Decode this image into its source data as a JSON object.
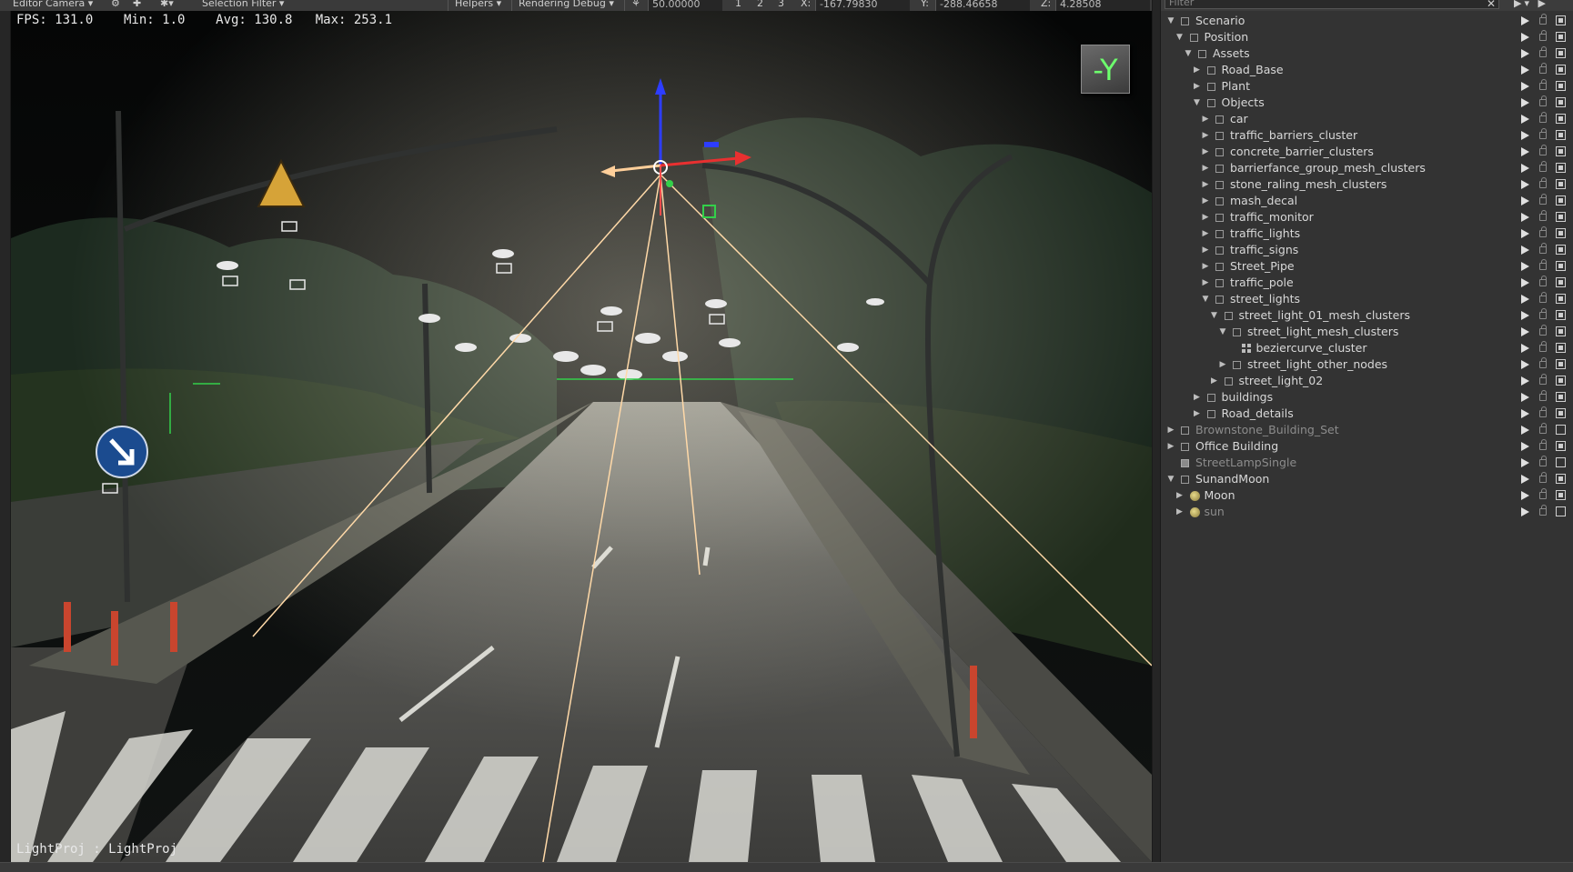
{
  "toolbar": {
    "camera": "Editor Camera ▾",
    "selection_filter": "Selection Filter ▾",
    "helpers": "Helpers ▾",
    "rendering_debug": "Rendering Debug ▾",
    "speed_value": "50.00000",
    "view_1": "1",
    "view_2": "2",
    "view_3": "3",
    "x_label": "X:",
    "x_value": "-167.79830",
    "y_label": "Y:",
    "y_value": "-288.46658",
    "z_label": "Z:",
    "z_value": "4.28508"
  },
  "viewport": {
    "stats": "FPS: 131.0    Min: 1.0    Avg: 130.8   Max: 253.1",
    "axis_label": "-Y",
    "camera_caption": "LightProj : LightProj"
  },
  "panel": {
    "filter_placeholder": "Filter",
    "clear_glyph": "✕",
    "tools_glyph": "▶▾ ▶"
  },
  "tree": [
    {
      "label": "Scenario",
      "depth": 0,
      "arrow": "▼",
      "icon": "checkbox",
      "dim": false,
      "visible": true
    },
    {
      "label": "Position",
      "depth": 1,
      "arrow": "▼",
      "icon": "checkbox",
      "dim": false,
      "visible": true
    },
    {
      "label": "Assets",
      "depth": 2,
      "arrow": "▼",
      "icon": "checkbox",
      "dim": false,
      "visible": true
    },
    {
      "label": "Road_Base",
      "depth": 3,
      "arrow": "▶",
      "icon": "checkbox",
      "dim": false,
      "visible": true
    },
    {
      "label": "Plant",
      "depth": 3,
      "arrow": "▶",
      "icon": "checkbox",
      "dim": false,
      "visible": true
    },
    {
      "label": "Objects",
      "depth": 3,
      "arrow": "▼",
      "icon": "checkbox",
      "dim": false,
      "visible": true
    },
    {
      "label": "car",
      "depth": 4,
      "arrow": "▶",
      "icon": "checkbox",
      "dim": false,
      "visible": true
    },
    {
      "label": "traffic_barriers_cluster",
      "depth": 4,
      "arrow": "▶",
      "icon": "checkbox",
      "dim": false,
      "visible": true
    },
    {
      "label": "concrete_barrier_clusters",
      "depth": 4,
      "arrow": "▶",
      "icon": "checkbox",
      "dim": false,
      "visible": true
    },
    {
      "label": "barrierfance_group_mesh_clusters",
      "depth": 4,
      "arrow": "▶",
      "icon": "checkbox",
      "dim": false,
      "visible": true
    },
    {
      "label": "stone_raling_mesh_clusters",
      "depth": 4,
      "arrow": "▶",
      "icon": "checkbox",
      "dim": false,
      "visible": true
    },
    {
      "label": "mash_decal",
      "depth": 4,
      "arrow": "▶",
      "icon": "checkbox",
      "dim": false,
      "visible": true
    },
    {
      "label": "traffic_monitor",
      "depth": 4,
      "arrow": "▶",
      "icon": "checkbox",
      "dim": false,
      "visible": true
    },
    {
      "label": "traffic_lights",
      "depth": 4,
      "arrow": "▶",
      "icon": "checkbox",
      "dim": false,
      "visible": true
    },
    {
      "label": "traffic_signs",
      "depth": 4,
      "arrow": "▶",
      "icon": "checkbox",
      "dim": false,
      "visible": true
    },
    {
      "label": "Street_Pipe",
      "depth": 4,
      "arrow": "▶",
      "icon": "checkbox",
      "dim": false,
      "visible": true
    },
    {
      "label": "traffic_pole",
      "depth": 4,
      "arrow": "▶",
      "icon": "checkbox",
      "dim": false,
      "visible": true
    },
    {
      "label": "street_lights",
      "depth": 4,
      "arrow": "▼",
      "icon": "checkbox",
      "dim": false,
      "visible": true
    },
    {
      "label": "street_light_01_mesh_clusters",
      "depth": 5,
      "arrow": "▼",
      "icon": "checkbox",
      "dim": false,
      "visible": true
    },
    {
      "label": "street_light_mesh_clusters",
      "depth": 6,
      "arrow": "▼",
      "icon": "checkbox",
      "dim": false,
      "visible": true
    },
    {
      "label": "beziercurve_cluster",
      "depth": 7,
      "arrow": "",
      "icon": "grid",
      "dim": false,
      "visible": true
    },
    {
      "label": "street_light_other_nodes",
      "depth": 6,
      "arrow": "▶",
      "icon": "checkbox",
      "dim": false,
      "visible": true
    },
    {
      "label": "street_light_02",
      "depth": 5,
      "arrow": "▶",
      "icon": "checkbox",
      "dim": false,
      "visible": true
    },
    {
      "label": "buildings",
      "depth": 3,
      "arrow": "▶",
      "icon": "checkbox",
      "dim": false,
      "visible": true
    },
    {
      "label": "Road_details",
      "depth": 3,
      "arrow": "▶",
      "icon": "checkbox",
      "dim": false,
      "visible": true
    },
    {
      "label": "Brownstone_Building_Set",
      "depth": 0,
      "arrow": "▶",
      "icon": "checkbox",
      "dim": true,
      "visible": false
    },
    {
      "label": "Office Building",
      "depth": 0,
      "arrow": "▶",
      "icon": "checkbox",
      "dim": false,
      "visible": true
    },
    {
      "label": "StreetLampSingle",
      "depth": 0,
      "arrow": "",
      "icon": "filled",
      "dim": true,
      "visible": false
    },
    {
      "label": "SunandMoon",
      "depth": 0,
      "arrow": "▼",
      "icon": "checkbox",
      "dim": false,
      "visible": true
    },
    {
      "label": "Moon",
      "depth": 1,
      "arrow": "▶",
      "icon": "light",
      "dim": false,
      "visible": true
    },
    {
      "label": "sun",
      "depth": 1,
      "arrow": "▶",
      "icon": "light",
      "dim": true,
      "visible": false
    }
  ]
}
